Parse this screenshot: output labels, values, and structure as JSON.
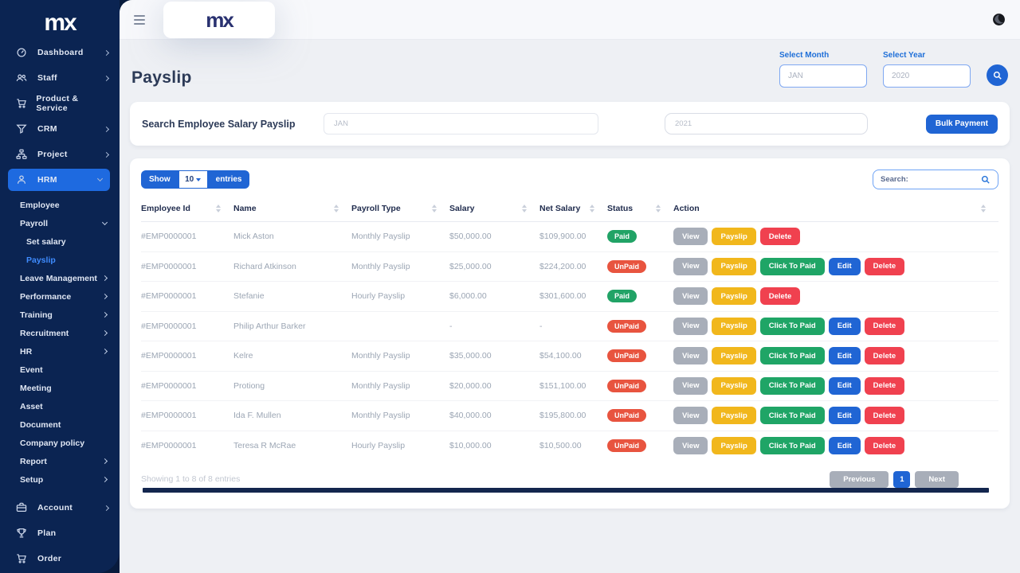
{
  "app": {
    "logo_text": "mx"
  },
  "topbar": {
    "theme_icon": "moon-icon",
    "menu_icon": "hamburger-icon"
  },
  "page": {
    "title": "Payslip"
  },
  "filters": {
    "month_label": "Select Month",
    "month_placeholder": "JAN",
    "year_label": "Select Year",
    "year_placeholder": "2020"
  },
  "search_card": {
    "label": "Search Employee Salary Payslip",
    "month_placeholder": "JAN",
    "year_placeholder": "2021",
    "bulk_button_label": "Bulk Payment"
  },
  "sidebar": {
    "items": [
      {
        "label": "Dashboard",
        "icon": "gauge-icon",
        "chevron": "right"
      },
      {
        "label": "Staff",
        "icon": "users-icon",
        "chevron": "right"
      },
      {
        "label": "Product & Service",
        "icon": "cart-icon",
        "chevron": ""
      },
      {
        "label": "CRM",
        "icon": "filter-icon",
        "chevron": "right"
      },
      {
        "label": "Project",
        "icon": "sitemap-icon",
        "chevron": "right"
      },
      {
        "label": "HRM",
        "icon": "user-icon",
        "chevron": "down",
        "active": true
      }
    ],
    "hrm_children": [
      {
        "label": "Employee"
      },
      {
        "label": "Payroll",
        "chevron": "down"
      },
      {
        "label": "Set salary",
        "indent": true
      },
      {
        "label": "Payslip",
        "indent": true,
        "active": true
      },
      {
        "label": "Leave Management",
        "chevron": "right"
      },
      {
        "label": "Performance",
        "chevron": "right"
      },
      {
        "label": "Training",
        "chevron": "right"
      },
      {
        "label": "Recruitment",
        "chevron": "right"
      },
      {
        "label": "HR",
        "chevron": "right"
      },
      {
        "label": "Event"
      },
      {
        "label": "Meeting"
      },
      {
        "label": "Asset"
      },
      {
        "label": "Document"
      },
      {
        "label": "Company policy"
      },
      {
        "label": "Report",
        "chevron": "right"
      },
      {
        "label": "Setup",
        "chevron": "right"
      }
    ],
    "footer_items": [
      {
        "label": "Account",
        "icon": "briefcase-icon",
        "chevron": "right"
      },
      {
        "label": "Plan",
        "icon": "trophy-icon",
        "chevron": ""
      },
      {
        "label": "Order",
        "icon": "bag-icon",
        "chevron": ""
      }
    ]
  },
  "table": {
    "show_label": "Show",
    "page_size": "10",
    "entries_label": "entries",
    "search_placeholder": "Search:",
    "columns": [
      "Employee Id",
      "Name",
      "Payroll Type",
      "Salary",
      "Net Salary",
      "Status",
      "Action"
    ],
    "rows": [
      {
        "employee_id": "#EMP0000001",
        "name": "Mick Aston",
        "payroll_type": "Monthly Payslip",
        "salary": "$50,000.00",
        "net_salary": "$109,900.00",
        "status": "Paid",
        "status_color": "green",
        "actions": [
          {
            "label": "View",
            "color": "gray"
          },
          {
            "label": "Payslip",
            "color": "yellow"
          },
          {
            "label": "Delete",
            "color": "red"
          }
        ]
      },
      {
        "employee_id": "#EMP0000001",
        "name": "Richard Atkinson",
        "payroll_type": "Monthly Payslip",
        "salary": "$25,000.00",
        "net_salary": "$224,200.00",
        "status": "UnPaid",
        "status_color": "red",
        "actions": [
          {
            "label": "View",
            "color": "gray"
          },
          {
            "label": "Payslip",
            "color": "yellow"
          },
          {
            "label": "Click To Paid",
            "color": "green"
          },
          {
            "label": "Edit",
            "color": "blue"
          },
          {
            "label": "Delete",
            "color": "red"
          }
        ]
      },
      {
        "employee_id": "#EMP0000001",
        "name": "Stefanie",
        "payroll_type": "Hourly Payslip",
        "salary": "$6,000.00",
        "net_salary": "$301,600.00",
        "status": "Paid",
        "status_color": "green",
        "actions": [
          {
            "label": "View",
            "color": "gray"
          },
          {
            "label": "Payslip",
            "color": "yellow"
          },
          {
            "label": "Delete",
            "color": "red"
          }
        ]
      },
      {
        "employee_id": "#EMP0000001",
        "name": "Philip Arthur Barker",
        "payroll_type": "",
        "salary": "-",
        "net_salary": "-",
        "status": "UnPaid",
        "status_color": "red",
        "actions": [
          {
            "label": "View",
            "color": "gray"
          },
          {
            "label": "Payslip",
            "color": "yellow"
          },
          {
            "label": "Click To Paid",
            "color": "green"
          },
          {
            "label": "Edit",
            "color": "blue"
          },
          {
            "label": "Delete",
            "color": "red"
          }
        ]
      },
      {
        "employee_id": "#EMP0000001",
        "name": "Kelre",
        "payroll_type": "Monthly Payslip",
        "salary": "$35,000.00",
        "net_salary": "$54,100.00",
        "status": "UnPaid",
        "status_color": "red",
        "actions": [
          {
            "label": "View",
            "color": "gray"
          },
          {
            "label": "Payslip",
            "color": "yellow"
          },
          {
            "label": "Click To Paid",
            "color": "green"
          },
          {
            "label": "Edit",
            "color": "blue"
          },
          {
            "label": "Delete",
            "color": "red"
          }
        ]
      },
      {
        "employee_id": "#EMP0000001",
        "name": "Protiong",
        "payroll_type": "Monthly Payslip",
        "salary": "$20,000.00",
        "net_salary": "$151,100.00",
        "status": "UnPaid",
        "status_color": "red",
        "actions": [
          {
            "label": "View",
            "color": "gray"
          },
          {
            "label": "Payslip",
            "color": "yellow"
          },
          {
            "label": "Click To Paid",
            "color": "green"
          },
          {
            "label": "Edit",
            "color": "blue"
          },
          {
            "label": "Delete",
            "color": "red"
          }
        ]
      },
      {
        "employee_id": "#EMP0000001",
        "name": "Ida F. Mullen",
        "payroll_type": "Monthly Payslip",
        "salary": "$40,000.00",
        "net_salary": "$195,800.00",
        "status": "UnPaid",
        "status_color": "red",
        "actions": [
          {
            "label": "View",
            "color": "gray"
          },
          {
            "label": "Payslip",
            "color": "yellow"
          },
          {
            "label": "Click To Paid",
            "color": "green"
          },
          {
            "label": "Edit",
            "color": "blue"
          },
          {
            "label": "Delete",
            "color": "red"
          }
        ]
      },
      {
        "employee_id": "#EMP0000001",
        "name": "Teresa R McRae",
        "payroll_type": "Hourly Payslip",
        "salary": "$10,000.00",
        "net_salary": "$10,500.00",
        "status": "UnPaid",
        "status_color": "red",
        "actions": [
          {
            "label": "View",
            "color": "gray"
          },
          {
            "label": "Payslip",
            "color": "yellow"
          },
          {
            "label": "Click To Paid",
            "color": "green"
          },
          {
            "label": "Edit",
            "color": "blue"
          },
          {
            "label": "Delete",
            "color": "red"
          }
        ]
      }
    ],
    "footer": {
      "showing_text": "Showing 1 to 8 of 8 entries",
      "previous_label": "Previous",
      "current_page": "1",
      "next_label": "Next"
    }
  },
  "colors": {
    "sidebar_bg": "#0b2452",
    "primary_blue": "#2065d4",
    "active_link_blue": "#3f8cff",
    "paid_green": "#21a366",
    "unpaid_red": "#e8543f",
    "payslip_yellow": "#f1b71c",
    "delete_red": "#f0414f",
    "view_gray": "#a8aeb9",
    "page_bg": "#eef0f4"
  }
}
